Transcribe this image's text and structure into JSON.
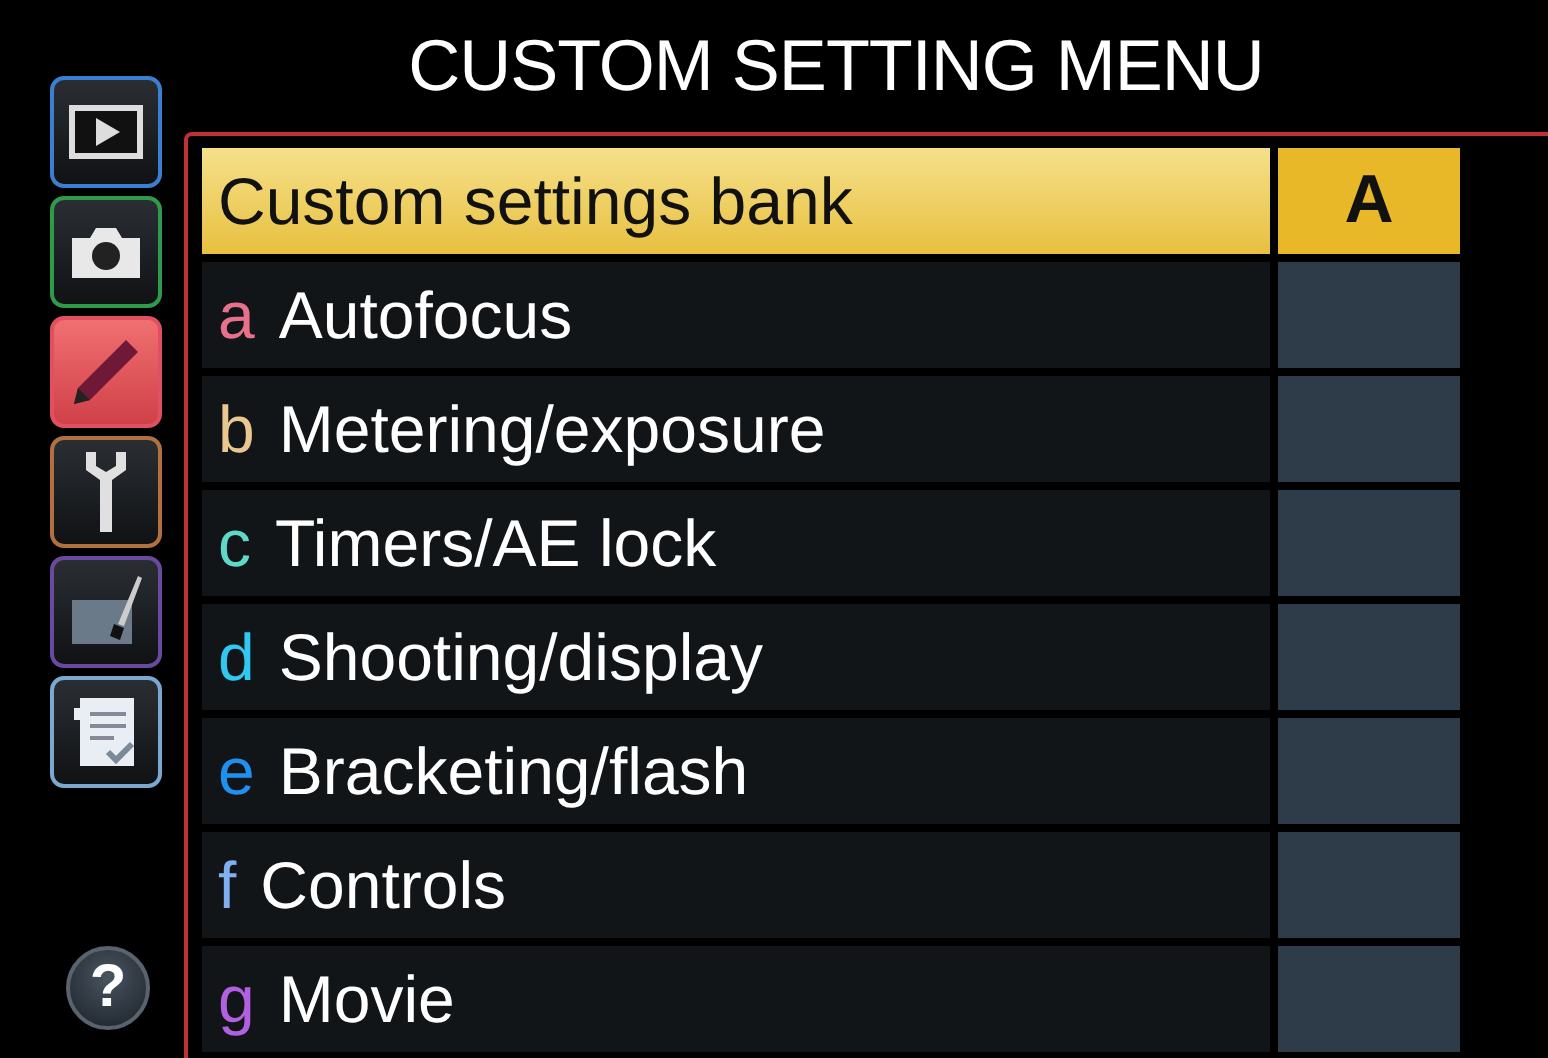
{
  "title": "CUSTOM SETTING MENU",
  "tabs": [
    {
      "kind": "playback",
      "color": "#3a7fd0",
      "selected": false
    },
    {
      "kind": "camera",
      "color": "#2f9a4a",
      "selected": false
    },
    {
      "kind": "pencil",
      "color": "#e05060",
      "selected": true
    },
    {
      "kind": "wrench",
      "color": "#b07040",
      "selected": false
    },
    {
      "kind": "retouch",
      "color": "#6a4aa0",
      "selected": false
    },
    {
      "kind": "list",
      "color": "#7aa8d0",
      "selected": false
    }
  ],
  "help": "?",
  "items": [
    {
      "kind": "setting",
      "label": "Custom settings bank",
      "value": "A",
      "selected": true
    },
    {
      "kind": "group",
      "letter": "a",
      "label": "Autofocus",
      "color": "#e8708a",
      "selected": false
    },
    {
      "kind": "group",
      "letter": "b",
      "label": "Metering/exposure",
      "color": "#e8c890",
      "selected": false
    },
    {
      "kind": "group",
      "letter": "c",
      "label": "Timers/AE lock",
      "color": "#60d8c8",
      "selected": false
    },
    {
      "kind": "group",
      "letter": "d",
      "label": "Shooting/display",
      "color": "#30c8f0",
      "selected": false
    },
    {
      "kind": "group",
      "letter": "e",
      "label": "Bracketing/flash",
      "color": "#2090f0",
      "selected": false
    },
    {
      "kind": "group",
      "letter": "f",
      "label": "Controls",
      "color": "#80b0f0",
      "selected": false
    },
    {
      "kind": "group",
      "letter": "g",
      "label": "Movie",
      "color": "#b060e0",
      "selected": false
    }
  ]
}
